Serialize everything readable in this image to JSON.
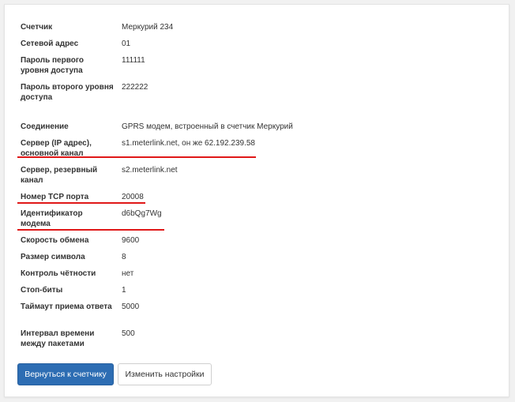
{
  "fields": [
    {
      "label": "Счетчик",
      "value": "Меркурий 234"
    },
    {
      "label": "Сетевой адрес",
      "value": "01"
    },
    {
      "label": "Пароль первого уровня доступа",
      "value": "111111"
    },
    {
      "label": "Пароль второго уровня доступа",
      "value": "222222"
    },
    {
      "label": "Соединение",
      "value": "GPRS модем, встроенный в счетчик Меркурий"
    },
    {
      "label": "Сервер (IP адрес), основной канал",
      "value": "s1.meterlink.net, он же 62.192.239.58"
    },
    {
      "label": "Сервер, резервный канал",
      "value": "s2.meterlink.net"
    },
    {
      "label": "Номер TCP порта",
      "value": "20008"
    },
    {
      "label": "Идентификатор модема",
      "value": "d6bQg7Wg"
    },
    {
      "label": "Скорость обмена",
      "value": "9600"
    },
    {
      "label": "Размер символа",
      "value": "8"
    },
    {
      "label": "Контроль чётности",
      "value": "нет"
    },
    {
      "label": "Стоп-биты",
      "value": "1"
    },
    {
      "label": "Таймаут приема ответа",
      "value": "5000"
    },
    {
      "label": "Интервал времени между пакетами",
      "value": "500"
    }
  ],
  "buttons": {
    "back_label": "Вернуться к счетчику",
    "edit_label": "Изменить настройки"
  },
  "colors": {
    "primary": "#2d6db3",
    "highlight_underline": "#e01818"
  }
}
